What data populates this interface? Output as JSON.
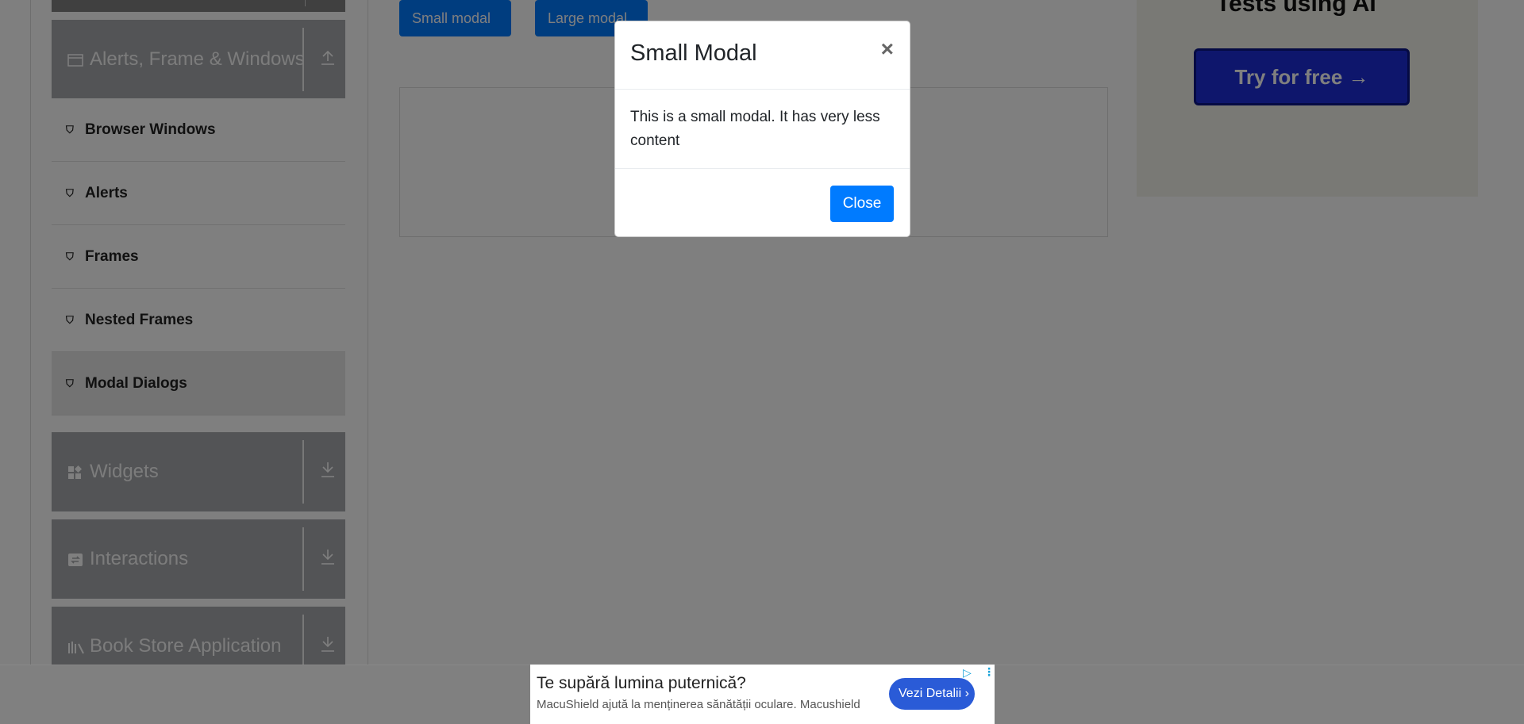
{
  "sidebar": {
    "groups": [
      {
        "label": "Alerts, Frame & Windows",
        "icon": "window-icon",
        "arrow": "collapse-up-icon"
      },
      {
        "label": "Widgets",
        "icon": "widgets-icon",
        "arrow": "expand-down-icon"
      },
      {
        "label": "Interactions",
        "icon": "interactions-icon",
        "arrow": "expand-down-icon"
      },
      {
        "label": "Book Store Application",
        "icon": "books-icon",
        "arrow": "expand-down-icon"
      }
    ],
    "items": [
      {
        "label": "Browser Windows"
      },
      {
        "label": "Alerts"
      },
      {
        "label": "Frames"
      },
      {
        "label": "Nested Frames"
      },
      {
        "label": "Modal Dialogs",
        "active": true
      }
    ]
  },
  "main": {
    "small_modal_button": "Small modal",
    "large_modal_button": "Large modal"
  },
  "side_ad": {
    "title": "Tests using AI",
    "button": "Try for free →"
  },
  "modal": {
    "title": "Small Modal",
    "close_x": "×",
    "body": "This is a small modal. It has very less content",
    "close_button": "Close"
  },
  "bottom_ad": {
    "title": "Te supără lumina puternică?",
    "subtitle": "MacuShield ajută la menținerea sănătății oculare. Macushield",
    "button": "Vezi Detalii"
  },
  "colors": {
    "primary": "#007bff",
    "sidebar_group": "#a6a9ad",
    "overlay": "rgba(0,0,0,0.5)"
  }
}
